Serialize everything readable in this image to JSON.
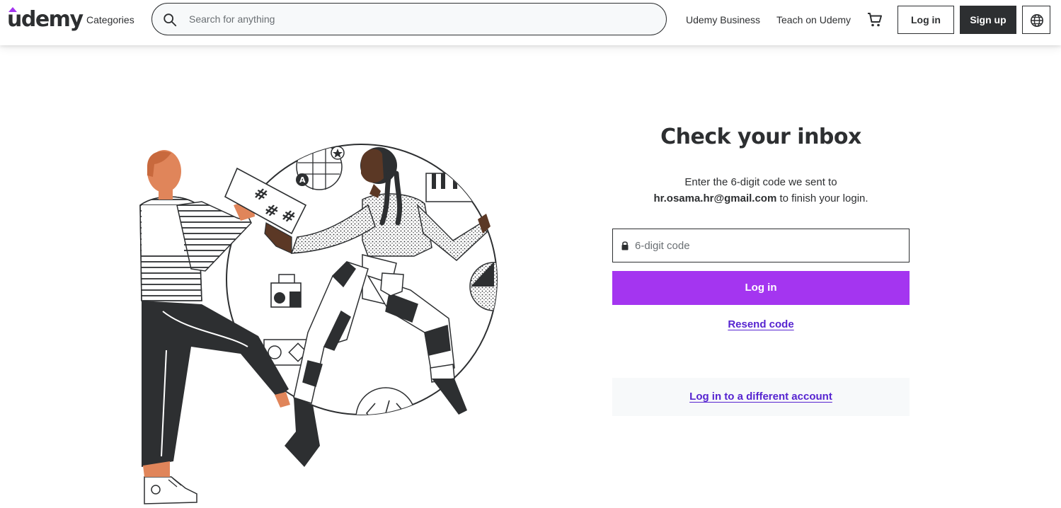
{
  "header": {
    "logo_text": "udemy",
    "categories_label": "Categories",
    "search_placeholder": "Search for anything",
    "udemy_business_label": "Udemy Business",
    "teach_label": "Teach on Udemy",
    "login_label": "Log in",
    "signup_label": "Sign up",
    "icons": [
      "search-icon",
      "cart-icon",
      "globe-icon"
    ]
  },
  "main": {
    "title": "Check your inbox",
    "desc_line1": "Enter the 6-digit code we sent to",
    "email": "hr.osama.hr@gmail.com",
    "desc_line2_suffix": " to finish your login.",
    "code_placeholder": "6-digit code",
    "login_button": "Log in",
    "resend_link": "Resend code",
    "different_account_link": "Log in to a different account"
  },
  "colors": {
    "accent": "#a435f0",
    "link": "#5624d0",
    "text": "#2d2f31",
    "panel_bg": "#f7f9fa"
  }
}
